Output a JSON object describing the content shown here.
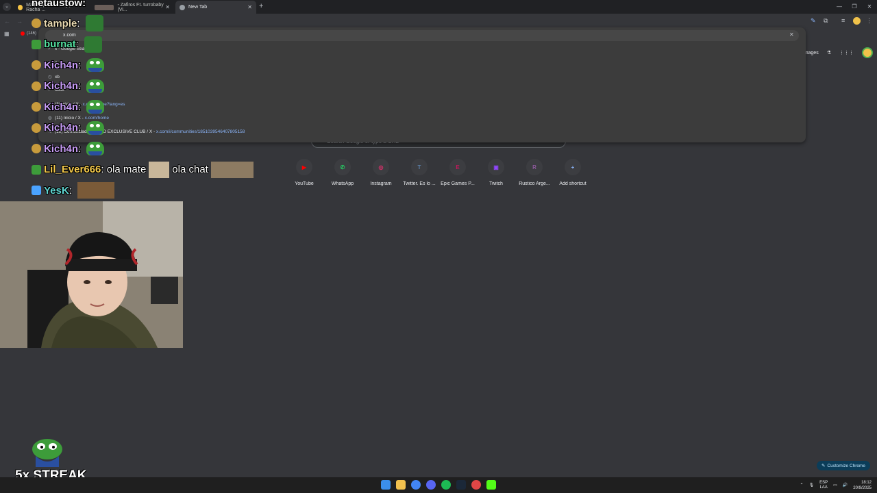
{
  "browser": {
    "tabs": [
      {
        "label": "Mattcapp - Ranking y Racha ...",
        "active": false
      },
      {
        "label": "- Zafiros Ft. turrobaby (Vi...",
        "active": false
      },
      {
        "label": "New Tab",
        "active": true
      }
    ],
    "bookmark": "(146)",
    "omnibox": {
      "input": "x.com",
      "suggestions": [
        {
          "icon": "search-icon",
          "text": "x - Google Search",
          "url": ""
        },
        {
          "icon": "search-icon",
          "text": "x",
          "url": ""
        },
        {
          "icon": "history-icon",
          "text": "xb",
          "url": ""
        },
        {
          "icon": "search-icon",
          "text": "xbox",
          "url": ""
        },
        {
          "icon": "x-logo-icon",
          "text": "(3) Inicio / X - ",
          "url": "x.com/home?lang=es"
        },
        {
          "icon": "globe-icon",
          "text": "(11) Inicio / X - ",
          "url": "x.com/home"
        },
        {
          "icon": "x-logo-icon",
          "text": "(19) Comunidad TROLEO EXCLUSIVE CLUB / X - ",
          "url": "x.com/i/communities/1851039546407805158"
        }
      ]
    }
  },
  "ntp": {
    "search_placeholder": "Search Google or type a URL",
    "top_links": {
      "images": "Images"
    },
    "shortcuts": [
      {
        "label": "YouTube",
        "icon": "youtube-icon",
        "color": "#ff0000",
        "glyph": "▶"
      },
      {
        "label": "WhatsApp",
        "icon": "whatsapp-icon",
        "color": "#25d366",
        "glyph": "✆"
      },
      {
        "label": "Instagram",
        "icon": "instagram-icon",
        "color": "#e1306c",
        "glyph": "◎"
      },
      {
        "label": "Twitter. Es lo ...",
        "icon": "letter-t-icon",
        "color": "#5b7fa6",
        "glyph": "T"
      },
      {
        "label": "Epic Games P...",
        "icon": "letter-e-icon",
        "color": "#c2185b",
        "glyph": "E"
      },
      {
        "label": "Twitch",
        "icon": "twitch-icon",
        "color": "#9146ff",
        "glyph": "▣"
      },
      {
        "label": "Rustico Arge...",
        "icon": "letter-r-icon",
        "color": "#8e5a9c",
        "glyph": "R"
      },
      {
        "label": "Add shortcut",
        "icon": "plus-icon",
        "color": "#8ab4f8",
        "glyph": "+"
      }
    ],
    "customize_label": "Customize Chrome"
  },
  "stream": {
    "alert_user": "netaustow:",
    "chat": [
      {
        "user": "tample",
        "user_color": "#e8d8b0",
        "badge": "cookie-badge-icon",
        "text": "",
        "emote": "bag-emote"
      },
      {
        "user": "burnat",
        "user_color": "#54e0a0",
        "badge": "pepe-badge-icon",
        "text": "",
        "emote": "bag-emote"
      },
      {
        "user": "Kich4n",
        "user_color": "#c79cf5",
        "badge": "cookie-badge-icon",
        "text": "",
        "emote": "pepe-emote"
      },
      {
        "user": "Kich4n",
        "user_color": "#c79cf5",
        "badge": "cookie-badge-icon",
        "text": "",
        "emote": "pepe-emote"
      },
      {
        "user": "Kich4n",
        "user_color": "#c79cf5",
        "badge": "cookie-badge-icon",
        "text": "",
        "emote": "pepe-emote"
      },
      {
        "user": "Kich4n",
        "user_color": "#c79cf5",
        "badge": "cookie-badge-icon",
        "text": "",
        "emote": "pepe-emote"
      },
      {
        "user": "Kich4n",
        "user_color": "#c79cf5",
        "badge": "cookie-badge-icon",
        "text": "",
        "emote": "pepe-emote"
      },
      {
        "user": "Lil_Ever666",
        "user_color": "#f2c84b",
        "badge": "pepe-badge-icon",
        "text": "ola mate",
        "text2": "ola chat",
        "emote": "cat-emote"
      },
      {
        "user": "YesK",
        "user_color": "#5fd4d0",
        "badge": "sword-badge-icon",
        "text": "",
        "emote": "crowd-emote"
      }
    ],
    "streak": "5x STREAK"
  },
  "taskbar": {
    "lang_top": "ESP",
    "lang_bottom": "LAA",
    "time": "18:12",
    "date": "20/9/2025"
  }
}
